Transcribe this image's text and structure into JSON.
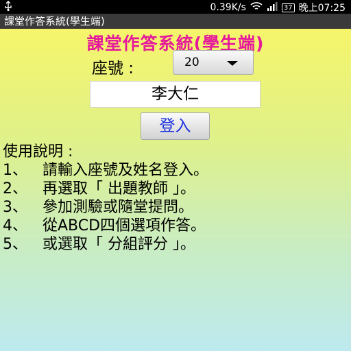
{
  "status_bar": {
    "speed": "0.39K/s",
    "battery": "37",
    "time": "晚上07:25"
  },
  "window_title": "課堂作答系統(學生端)",
  "app_title": "課堂作答系統(學生端)",
  "seat": {
    "label": "座號 :",
    "value": "20"
  },
  "name_value": "李大仁",
  "login_label": "登入",
  "instructions": {
    "heading": "使用說明 :",
    "items": [
      {
        "num": "1、",
        "text": "請輸入座號及姓名登入。"
      },
      {
        "num": "2、",
        "text": "再選取「 出題教師 」。"
      },
      {
        "num": "3、",
        "text": "參加測驗或隨堂提問。"
      },
      {
        "num": "4、",
        "text": "從ABCD四個選項作答。"
      },
      {
        "num": "5、",
        "text": "或選取「 分組評分 」。"
      }
    ]
  },
  "colors": {
    "title_magenta": "#e5199b",
    "login_blue": "#1a2fe0"
  }
}
